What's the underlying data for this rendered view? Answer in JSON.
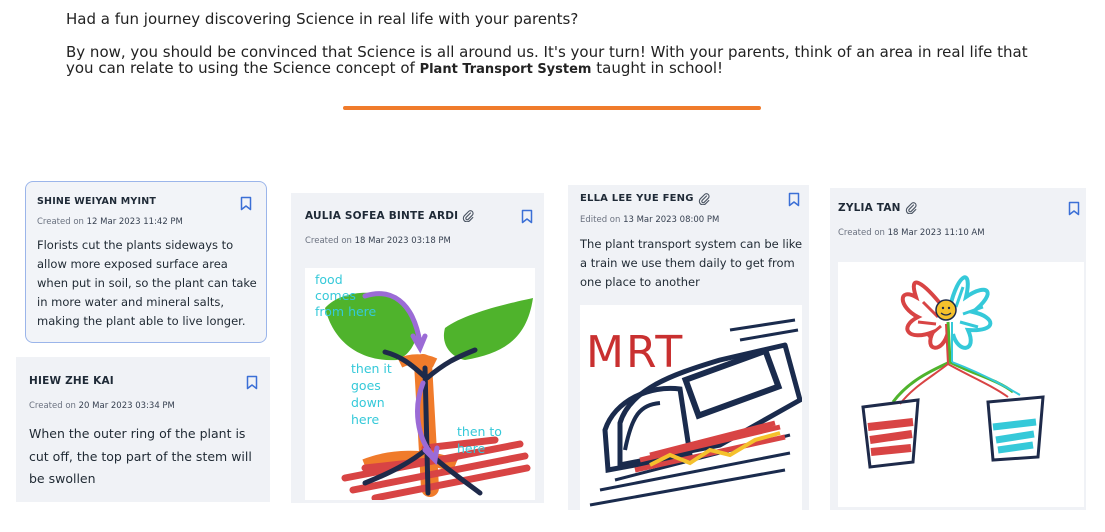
{
  "intro": {
    "question": "Had a fun journey discovering Science in real life with your parents?",
    "body_before": "By now, you should be convinced that Science is all around us. It's your turn! With your parents, think of an area in real life that you can relate to using the Science concept of ",
    "concept": "Plant Transport System",
    "body_after": " taught in school!"
  },
  "colors": {
    "divider": "#f07b2b",
    "card_background": "#f0f2f6",
    "selected_border": "#9bb5ea",
    "bookmark": "#3b6fd6",
    "scribble_cyan": "#35c9d9"
  },
  "posts": [
    {
      "author": "SHINE WEIYAN MYINT",
      "meta_label": "Created on",
      "date": "12 Mar 2023 11:42 PM",
      "text": "Florists cut the plants sideways to allow more exposed surface area when put in soil, so the plant can take in more water and mineral salts, making the plant able to live longer.",
      "has_attachment": false
    },
    {
      "author": "HIEW ZHE KAI",
      "meta_label": "Created on",
      "date": "20 Mar 2023 03:34 PM",
      "text": "When the outer ring of the plant is cut off, the top part of the stem will be swollen",
      "has_attachment": false
    },
    {
      "author": "AULIA SOFEA BINTE ARDI",
      "meta_label": "Created on",
      "date": "18 Mar 2023 03:18 PM",
      "has_attachment": true,
      "drawing": {
        "label_1": "food",
        "label_2": "comes",
        "label_3": "from here",
        "label_4": "then it",
        "label_5": "goes",
        "label_6": "down",
        "label_7": "here",
        "label_8": "then to",
        "label_9": "here"
      }
    },
    {
      "author": "ELLA LEE YUE FENG",
      "meta_label": "Edited on",
      "date": "13 Mar 2023 08:00 PM",
      "text": "The plant transport system can be like a train we use them daily to get from one place to another",
      "has_attachment": true,
      "drawing": {
        "label": "MRT"
      }
    },
    {
      "author": "ZYLIA TAN",
      "meta_label": "Created on",
      "date": "18 Mar 2023 11:10 AM",
      "has_attachment": true
    }
  ]
}
